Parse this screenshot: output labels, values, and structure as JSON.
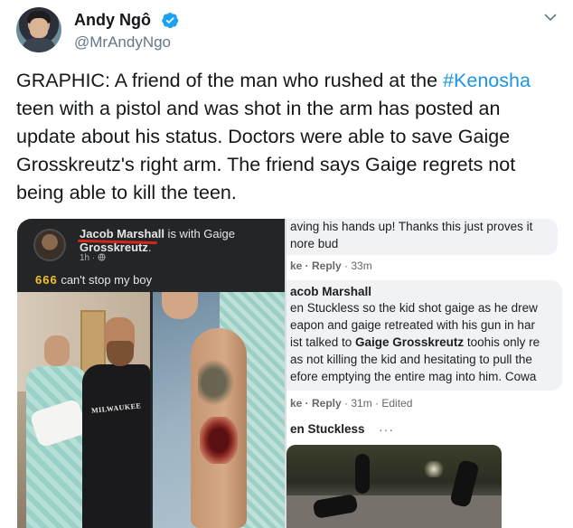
{
  "tweet": {
    "display_name": "Andy Ngô",
    "handle": "@MrAndyNgo",
    "verified": true,
    "text_before_hashtag": "GRAPHIC: A friend of the man who rushed at the",
    "hashtag": "#Kenosha",
    "text_after_hashtag": " teen with a pistol and was shot in the arm has posted an update about his status. Doctors were able to save Gaige Grosskreutz's right arm. The friend says Gaige regrets not being able to kill the teen."
  },
  "left_post": {
    "author": "Jacob Marshall",
    "with_text": " is with Gaige",
    "tagged": "Grosskreutz",
    "tagged_suffix": ".",
    "time": "1h · ",
    "emoji": "666",
    "comment": " can't stop my boy",
    "photo_text": "MILWAUKEE"
  },
  "right_post": {
    "line_1": "aving his hands up! Thanks this just proves it",
    "line_2": "nore bud",
    "meta_1_actions": "ke · Reply",
    "meta_1_time": " · 33m",
    "commenter": "acob Marshall",
    "comment_lines": [
      "en Stuckless so the kid shot gaige as he drew",
      "eapon and gaige retreated with his gun in har",
      "ist talked to ",
      "as not killing the kid and hesitating to pull the",
      "efore emptying the entire mag into him. Cowa"
    ],
    "bold_name": "Gaige Grosskreutz",
    "line_3_rest": " toohis only re",
    "meta_2_actions": "ke · Reply",
    "meta_2_time": " · 31m · Edited",
    "next_commenter": "en Stuckless",
    "ellipsis": "···"
  },
  "colors": {
    "hashtag": "#1b95e0",
    "verified": "#1da1f2",
    "underline": "#d0261c"
  },
  "icons": [
    "verified-icon",
    "caret-down-icon",
    "globe-icon"
  ]
}
